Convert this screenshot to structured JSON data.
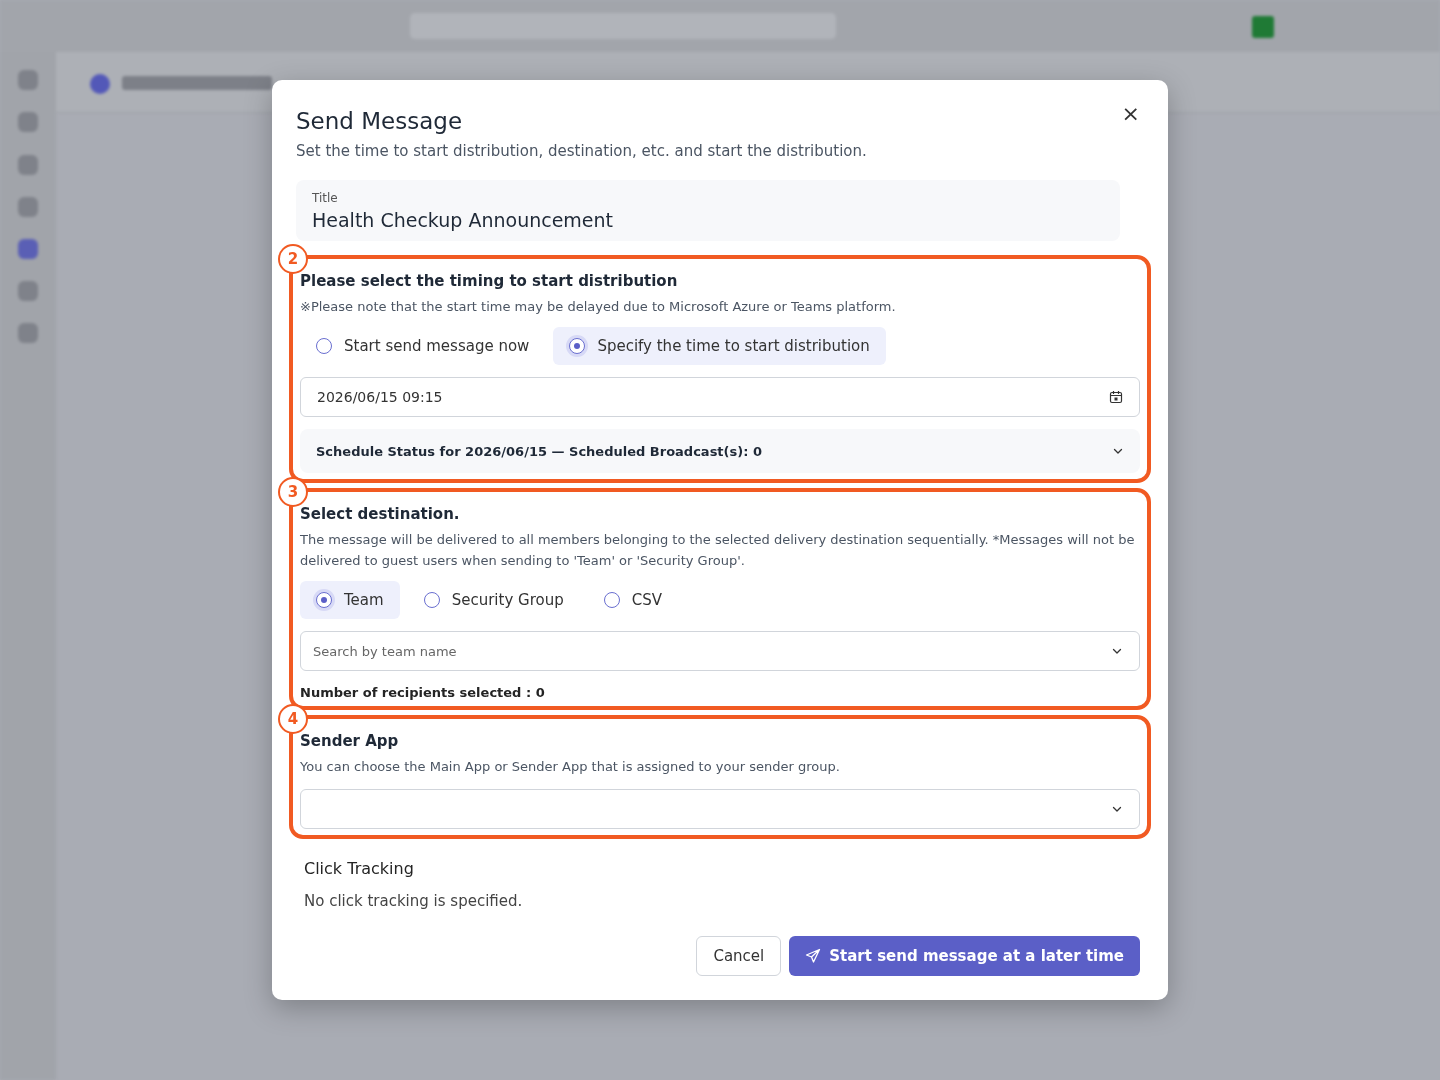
{
  "dialog": {
    "title": "Send Message",
    "subtitle": "Set the time to start distribution, destination, etc. and start the distribution.",
    "close": "×"
  },
  "title_field": {
    "label": "Title",
    "value": "Health Checkup Announcement"
  },
  "timing": {
    "badge": "2",
    "heading": "Please select the timing to start distribution",
    "note": "※Please note that the start time may be delayed due to Microsoft Azure or Teams platform.",
    "options": [
      {
        "label": "Start send message now",
        "selected": false
      },
      {
        "label": "Specify the time to start distribution",
        "selected": true
      }
    ],
    "datetime": "2026/06/15 09:15",
    "schedule_status": "Schedule Status for 2026/06/15 — Scheduled Broadcast(s): 0"
  },
  "destination": {
    "badge": "3",
    "heading": "Select destination.",
    "description": "The message will be delivered to all members belonging to the selected delivery destination sequentially. *Messages will not be delivered to guest users when sending to 'Team' or 'Security Group'.",
    "options": [
      {
        "label": "Team",
        "selected": true
      },
      {
        "label": "Security Group",
        "selected": false
      },
      {
        "label": "CSV",
        "selected": false
      }
    ],
    "search": {
      "placeholder": "Search by team name"
    },
    "recipients": "Number of recipients selected : 0"
  },
  "sender_app": {
    "badge": "4",
    "heading": "Sender App",
    "description": "You can choose the Main App or Sender App that is assigned to your sender group."
  },
  "click_tracking": {
    "heading": "Click Tracking",
    "text": "No click tracking is specified."
  },
  "buttons": {
    "cancel": "Cancel",
    "primary": "Start send message at a later time"
  }
}
